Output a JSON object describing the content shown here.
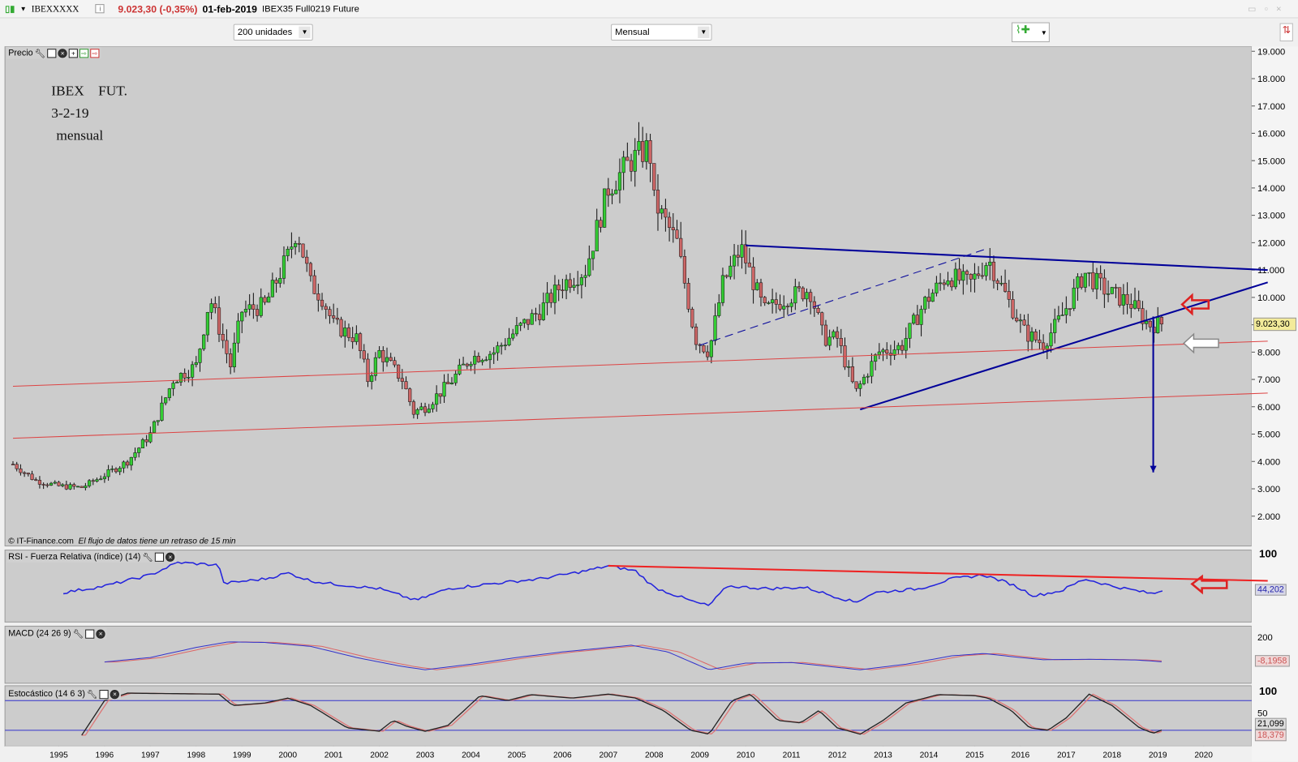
{
  "header": {
    "symbol": "IBEXXXXX",
    "info_icon": "i",
    "price_change": "9.023,30 (-0,35%)",
    "date": "01-feb-2019",
    "description": "IBEX35 Full0219 Future"
  },
  "toolbar": {
    "units_select": "200 unidades",
    "period_select": "Mensual"
  },
  "price_panel": {
    "title": "Precio",
    "annotation": [
      "IBEX",
      "FUT.",
      "3-2-19",
      "mensual"
    ],
    "copyright": "© IT-Finance.com",
    "delay_note": "El flujo de datos tiene un retraso de 15 min",
    "last_price_label": "9.023,30"
  },
  "rsi_panel": {
    "title": "RSI - Fuerza Relativa (índice) (14)",
    "tick_label": "100",
    "value_label": "44,202"
  },
  "macd_panel": {
    "title": "MACD (24 26 9)",
    "tick_label": "200",
    "value_label": "-8,1958"
  },
  "stoch_panel": {
    "title": "Estocástico (14 6 3)",
    "tick_labels": [
      "100",
      "50"
    ],
    "k_label": "21,099",
    "d_label": "18,379"
  },
  "colors": {
    "up": "#33cc33",
    "down": "#cc6666",
    "trend": "#000099",
    "support": "#dd4444",
    "rsi": "#2222dd",
    "stoch_band": "#3333cc",
    "price_red": "#cc3333"
  },
  "chart_data": [
    {
      "type": "candlestick",
      "name": "Precio",
      "xlim": [
        1994,
        2021.4
      ],
      "ylim": [
        1300,
        19200
      ],
      "y_ticks": [
        "2.000",
        "3.000",
        "4.000",
        "5.000",
        "6.000",
        "7.000",
        "8.000",
        "9.000",
        "10.000",
        "11.000",
        "12.000",
        "13.000",
        "14.000",
        "15.000",
        "16.000",
        "17.000",
        "18.000",
        "19.000"
      ],
      "x_ticks": [
        "1995",
        "1996",
        "1997",
        "1998",
        "1999",
        "2000",
        "2001",
        "2002",
        "2003",
        "2004",
        "2005",
        "2006",
        "2007",
        "2008",
        "2009",
        "2010",
        "2011",
        "2012",
        "2013",
        "2014",
        "2015",
        "2016",
        "2017",
        "2018",
        "2019",
        "2020"
      ],
      "close_keypoints": [
        [
          1994.0,
          3900
        ],
        [
          1994.5,
          3300
        ],
        [
          1995.0,
          3100
        ],
        [
          1995.5,
          3050
        ],
        [
          1996.0,
          3500
        ],
        [
          1996.5,
          4000
        ],
        [
          1997.0,
          5000
        ],
        [
          1997.5,
          7000
        ],
        [
          1998.0,
          7500
        ],
        [
          1998.3,
          10000
        ],
        [
          1998.75,
          7500
        ],
        [
          1999.0,
          9500
        ],
        [
          1999.5,
          9700
        ],
        [
          2000.0,
          11500
        ],
        [
          2000.2,
          12500
        ],
        [
          2000.5,
          10500
        ],
        [
          2000.75,
          10000
        ],
        [
          2001.0,
          9000
        ],
        [
          2001.5,
          8500
        ],
        [
          2001.75,
          7000
        ],
        [
          2002.0,
          8000
        ],
        [
          2002.5,
          7000
        ],
        [
          2002.75,
          5800
        ],
        [
          2003.0,
          6000
        ],
        [
          2003.5,
          6800
        ],
        [
          2004.0,
          7800
        ],
        [
          2004.5,
          8000
        ],
        [
          2005.0,
          8800
        ],
        [
          2005.5,
          9500
        ],
        [
          2006.0,
          10500
        ],
        [
          2006.5,
          11000
        ],
        [
          2006.75,
          12500
        ],
        [
          2007.0,
          14000
        ],
        [
          2007.5,
          15000
        ],
        [
          2007.9,
          15500
        ],
        [
          2008.0,
          13500
        ],
        [
          2008.5,
          12000
        ],
        [
          2008.9,
          8500
        ],
        [
          2009.2,
          8000
        ],
        [
          2009.5,
          10500
        ],
        [
          2009.9,
          11800
        ],
        [
          2010.4,
          9500
        ],
        [
          2010.9,
          10000
        ],
        [
          2011.4,
          10300
        ],
        [
          2011.7,
          8500
        ],
        [
          2012.0,
          8500
        ],
        [
          2012.4,
          6500
        ],
        [
          2012.9,
          8000
        ],
        [
          2013.4,
          8200
        ],
        [
          2013.9,
          9800
        ],
        [
          2014.4,
          10800
        ],
        [
          2014.9,
          10500
        ],
        [
          2015.3,
          11400
        ],
        [
          2015.7,
          10000
        ],
        [
          2016.1,
          8700
        ],
        [
          2016.5,
          8300
        ],
        [
          2016.9,
          9300
        ],
        [
          2017.4,
          10900
        ],
        [
          2017.9,
          10200
        ],
        [
          2018.4,
          9800
        ],
        [
          2018.8,
          9000
        ],
        [
          2019.1,
          9023.3
        ]
      ],
      "trendlines": [
        {
          "kind": "resistance",
          "color": "#000099",
          "from": [
            2010.0,
            11900
          ],
          "to": [
            2021.4,
            11000
          ]
        },
        {
          "kind": "support",
          "color": "#000099",
          "from": [
            2012.5,
            5900
          ],
          "to": [
            2021.4,
            10550
          ]
        },
        {
          "kind": "dashed",
          "color": "#000099",
          "from": [
            2009.0,
            8250
          ],
          "to": [
            2015.3,
            11800
          ]
        },
        {
          "kind": "channel",
          "color": "#dd4444",
          "from": [
            1994.0,
            6750
          ],
          "to": [
            2021.4,
            8400
          ]
        },
        {
          "kind": "channel",
          "color": "#dd4444",
          "from": [
            1994.0,
            4850
          ],
          "to": [
            2021.4,
            6500
          ]
        },
        {
          "kind": "target-arrow",
          "color": "#000099",
          "from": [
            2018.9,
            9300
          ],
          "to": [
            2018.9,
            3600
          ]
        }
      ]
    },
    {
      "type": "line",
      "name": "RSI",
      "ylim": [
        -5,
        105
      ],
      "values": [
        [
          1995.1,
          40
        ],
        [
          1996,
          50
        ],
        [
          1997,
          67
        ],
        [
          1997.6,
          86
        ],
        [
          1998.5,
          82
        ],
        [
          1998.6,
          54
        ],
        [
          1999.5,
          61
        ],
        [
          2000,
          70
        ],
        [
          2000.5,
          58
        ],
        [
          2001,
          53
        ],
        [
          2002,
          46
        ],
        [
          2002.8,
          28
        ],
        [
          2003.5,
          46
        ],
        [
          2004.5,
          54
        ],
        [
          2005.5,
          61
        ],
        [
          2006.5,
          73
        ],
        [
          2007,
          81
        ],
        [
          2007.6,
          73
        ],
        [
          2008,
          48
        ],
        [
          2008.9,
          25
        ],
        [
          2009.2,
          20
        ],
        [
          2009.6,
          50
        ],
        [
          2010.5,
          46
        ],
        [
          2011.3,
          48
        ],
        [
          2011.9,
          35
        ],
        [
          2012.4,
          25
        ],
        [
          2012.8,
          40
        ],
        [
          2013.8,
          46
        ],
        [
          2014.5,
          61
        ],
        [
          2015.2,
          67
        ],
        [
          2015.8,
          53
        ],
        [
          2016.3,
          35
        ],
        [
          2016.9,
          43
        ],
        [
          2017.4,
          61
        ],
        [
          2018,
          50
        ],
        [
          2018.9,
          38
        ],
        [
          2019.1,
          44.2
        ]
      ],
      "trendline": {
        "from": [
          2007.0,
          81
        ],
        "to": [
          2021.4,
          58
        ]
      }
    },
    {
      "type": "line",
      "name": "MACD",
      "ylim": [
        -201,
        311
      ],
      "values": [
        [
          1996,
          -10
        ],
        [
          1997,
          30
        ],
        [
          1998,
          120
        ],
        [
          1998.7,
          170
        ],
        [
          1999.5,
          165
        ],
        [
          2000.5,
          130
        ],
        [
          2001.5,
          30
        ],
        [
          2002.5,
          -50
        ],
        [
          2003,
          -80
        ],
        [
          2004,
          -30
        ],
        [
          2005,
          30
        ],
        [
          2006,
          80
        ],
        [
          2007.5,
          140
        ],
        [
          2008.3,
          80
        ],
        [
          2009.2,
          -80
        ],
        [
          2010,
          -20
        ],
        [
          2011,
          -15
        ],
        [
          2012.5,
          -80
        ],
        [
          2013.5,
          -30
        ],
        [
          2014.5,
          45
        ],
        [
          2015.2,
          66
        ],
        [
          2016,
          30
        ],
        [
          2016.5,
          10
        ],
        [
          2017.5,
          14
        ],
        [
          2018.5,
          8
        ],
        [
          2019.1,
          -8.2
        ]
      ]
    },
    {
      "type": "line",
      "name": "Estocástico",
      "ylim": [
        -12,
        110
      ],
      "bands": [
        80,
        20
      ],
      "values": [
        [
          1995.5,
          10
        ],
        [
          1996,
          80
        ],
        [
          1996.5,
          95
        ],
        [
          1998.5,
          93
        ],
        [
          1998.8,
          70
        ],
        [
          1999.5,
          75
        ],
        [
          2000,
          85
        ],
        [
          2000.5,
          70
        ],
        [
          2001.3,
          25
        ],
        [
          2002,
          18
        ],
        [
          2002.3,
          40
        ],
        [
          2002.6,
          28
        ],
        [
          2003,
          18
        ],
        [
          2003.5,
          30
        ],
        [
          2004.2,
          90
        ],
        [
          2004.8,
          80
        ],
        [
          2005.3,
          92
        ],
        [
          2006.2,
          85
        ],
        [
          2007,
          93
        ],
        [
          2007.6,
          85
        ],
        [
          2008.2,
          60
        ],
        [
          2008.8,
          20
        ],
        [
          2009.2,
          12
        ],
        [
          2009.7,
          80
        ],
        [
          2010.1,
          93
        ],
        [
          2010.7,
          40
        ],
        [
          2011.2,
          35
        ],
        [
          2011.6,
          60
        ],
        [
          2012.0,
          25
        ],
        [
          2012.5,
          12
        ],
        [
          2013.0,
          40
        ],
        [
          2013.5,
          75
        ],
        [
          2014.2,
          92
        ],
        [
          2015,
          90
        ],
        [
          2015.3,
          85
        ],
        [
          2015.8,
          60
        ],
        [
          2016.2,
          25
        ],
        [
          2016.6,
          20
        ],
        [
          2017,
          45
        ],
        [
          2017.5,
          93
        ],
        [
          2018,
          70
        ],
        [
          2018.6,
          25
        ],
        [
          2018.9,
          14
        ],
        [
          2019.1,
          21.1
        ]
      ]
    }
  ]
}
